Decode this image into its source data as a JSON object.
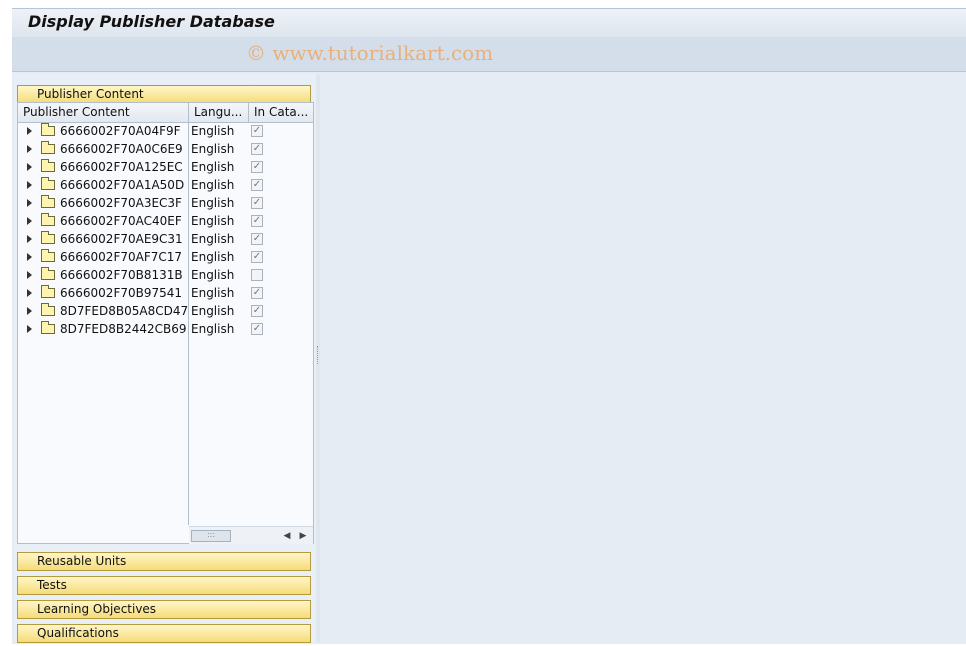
{
  "title": "Display Publisher Database",
  "watermark": "© www.tutorialkart.com",
  "panels": {
    "publisher_content": "Publisher Content",
    "reusable_units": "Reusable Units",
    "tests": "Tests",
    "learning_objectives": "Learning Objectives",
    "qualifications": "Qualifications"
  },
  "tree": {
    "columns": [
      "Publisher Content",
      "Langu...",
      "In Cata..."
    ],
    "rows": [
      {
        "name": "6666002F70A04F9F",
        "language": "English",
        "in_catalog": true
      },
      {
        "name": "6666002F70A0C6E9",
        "language": "English",
        "in_catalog": true
      },
      {
        "name": "6666002F70A125EC",
        "language": "English",
        "in_catalog": true
      },
      {
        "name": "6666002F70A1A50D",
        "language": "English",
        "in_catalog": true
      },
      {
        "name": "6666002F70A3EC3F",
        "language": "English",
        "in_catalog": true
      },
      {
        "name": "6666002F70AC40EF",
        "language": "English",
        "in_catalog": true
      },
      {
        "name": "6666002F70AE9C31",
        "language": "English",
        "in_catalog": true
      },
      {
        "name": "6666002F70AF7C17",
        "language": "English",
        "in_catalog": true
      },
      {
        "name": "6666002F70B8131B",
        "language": "English",
        "in_catalog": false
      },
      {
        "name": "6666002F70B97541",
        "language": "English",
        "in_catalog": true
      },
      {
        "name": "8D7FED8B05A8CD47",
        "language": "English",
        "in_catalog": true
      },
      {
        "name": "8D7FED8B2442CB69",
        "language": "English",
        "in_catalog": true
      }
    ]
  },
  "icons": {
    "expand": "chevron-right-icon",
    "folder": "folder-icon",
    "checkbox": "checkbox-icon"
  }
}
